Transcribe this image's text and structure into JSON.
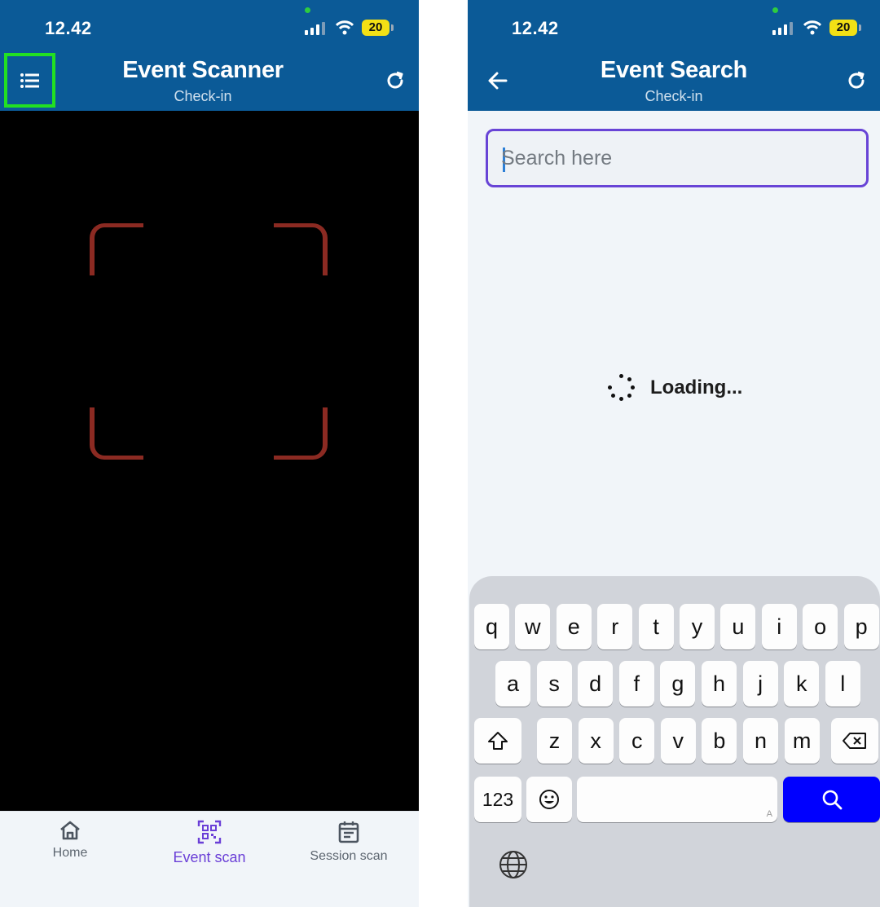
{
  "left_screen": {
    "status": {
      "time": "12.42",
      "battery": "20"
    },
    "header": {
      "title": "Event Scanner",
      "subtitle": "Check-in"
    },
    "icons": {
      "menu": "list-menu-icon",
      "refresh": "refresh-icon"
    },
    "bottom_nav": [
      {
        "label": "Home",
        "icon": "home-icon",
        "active": false
      },
      {
        "label": "Event scan",
        "icon": "qr-scan-icon",
        "active": true
      },
      {
        "label": "Session scan",
        "icon": "calendar-icon",
        "active": false
      }
    ],
    "colors": {
      "header": "#0b5a97",
      "highlight": "#22e022",
      "scan_frame": "#8b2a22",
      "active_nav": "#6a3fd7"
    }
  },
  "right_screen": {
    "status": {
      "time": "12.42",
      "battery": "20"
    },
    "header": {
      "title": "Event Search",
      "subtitle": "Check-in"
    },
    "icons": {
      "back": "arrow-left-icon",
      "refresh": "refresh-icon"
    },
    "search": {
      "placeholder": "Search here",
      "value": ""
    },
    "loading_text": "Loading...",
    "keyboard": {
      "row1": [
        "q",
        "w",
        "e",
        "r",
        "t",
        "y",
        "u",
        "i",
        "o",
        "p"
      ],
      "row2": [
        "a",
        "s",
        "d",
        "f",
        "g",
        "h",
        "j",
        "k",
        "l"
      ],
      "row3": [
        "z",
        "x",
        "c",
        "v",
        "b",
        "n",
        "m"
      ],
      "numbers_key": "123",
      "space_hint": "A"
    },
    "colors": {
      "search_border": "#6844d6",
      "search_key": "#0000ff"
    }
  }
}
